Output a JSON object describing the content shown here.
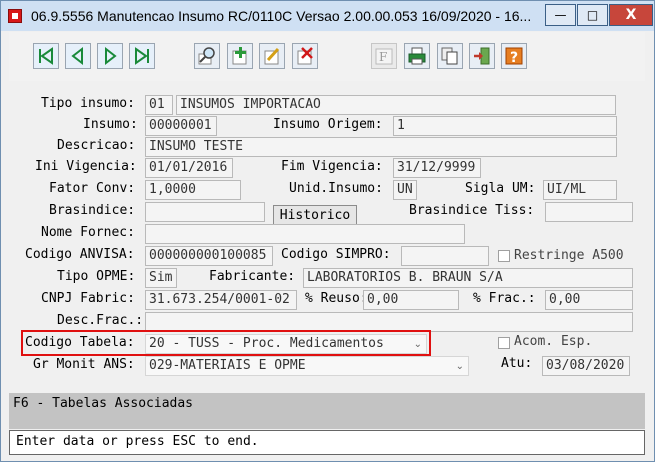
{
  "window": {
    "title": "06.9.5556 Manutencao  Insumo RC/0110C Versao 2.00.00.053 16/09/2020 - 16...",
    "minimize_glyph": "—",
    "maximize_glyph": "□",
    "close_glyph": "X"
  },
  "toolbar": {
    "icons": [
      "first-record-icon",
      "previous-record-icon",
      "next-record-icon",
      "last-record-icon",
      "search-icon",
      "add-icon",
      "edit-icon",
      "delete-icon",
      "function-icon",
      "print-icon",
      "copy-icon",
      "exit-icon",
      "help-icon"
    ]
  },
  "form": {
    "tipo_insumo": {
      "label": "Tipo insumo:",
      "code": "01",
      "desc": "INSUMOS IMPORTACAO"
    },
    "insumo": {
      "label": "Insumo:",
      "value": "00000001"
    },
    "insumo_origem": {
      "label": "Insumo Origem:",
      "value": "1"
    },
    "descricao": {
      "label": "Descricao:",
      "value": "INSUMO TESTE"
    },
    "ini_vigencia": {
      "label": "Ini Vigencia:",
      "value": "01/01/2016"
    },
    "fim_vigencia": {
      "label": "Fim Vigencia:",
      "value": "31/12/9999"
    },
    "fator_conv": {
      "label": "Fator Conv:",
      "value": "1,0000"
    },
    "unid_insumo": {
      "label": "Unid.Insumo:",
      "value": "UN"
    },
    "sigla_um": {
      "label": "Sigla UM:",
      "value": "UI/ML"
    },
    "brasindice": {
      "label": "Brasindice:",
      "value": ""
    },
    "historico_button": "Historico",
    "brasindice_tiss": {
      "label": "Brasindice Tiss:",
      "value": ""
    },
    "nome_fornec": {
      "label": "Nome Fornec:",
      "value": ""
    },
    "codigo_anvisa": {
      "label": "Codigo ANVISA:",
      "value": "000000000100085"
    },
    "codigo_simpro": {
      "label": "Codigo SIMPRO:",
      "value": ""
    },
    "restringe_a500": {
      "label": "Restringe A500",
      "checked": false
    },
    "tipo_opme": {
      "label": "Tipo OPME:",
      "value": "Sim"
    },
    "fabricante": {
      "label": "Fabricante:",
      "value": "LABORATORIOS B. BRAUN S/A"
    },
    "cnpj_fabric": {
      "label": "CNPJ Fabric:",
      "value": "31.673.254/0001-02"
    },
    "pct_reuso": {
      "label": "% Reuso:",
      "value": "0,00"
    },
    "pct_frac": {
      "label": "% Frac.:",
      "value": "0,00"
    },
    "desc_frac": {
      "label": "Desc.Frac.:",
      "value": ""
    },
    "codigo_tabela": {
      "label": "Codigo Tabela:",
      "value": "20 - TUSS - Proc. Medicamentos"
    },
    "acom_esp": {
      "label": "Acom. Esp.",
      "checked": false
    },
    "gr_monit_ans": {
      "label": "Gr Monit ANS:",
      "value": "029-MATERIAIS E OPME"
    },
    "atu": {
      "label": "Atu:",
      "value": "03/08/2020"
    }
  },
  "status": {
    "function_keys": "F6 - Tabelas Associadas",
    "message": "Enter data or press ESC to end."
  },
  "colors": {
    "highlight_border": "#e01010",
    "titlebar": "#cfe0f3",
    "close_button": "#c7463b"
  }
}
